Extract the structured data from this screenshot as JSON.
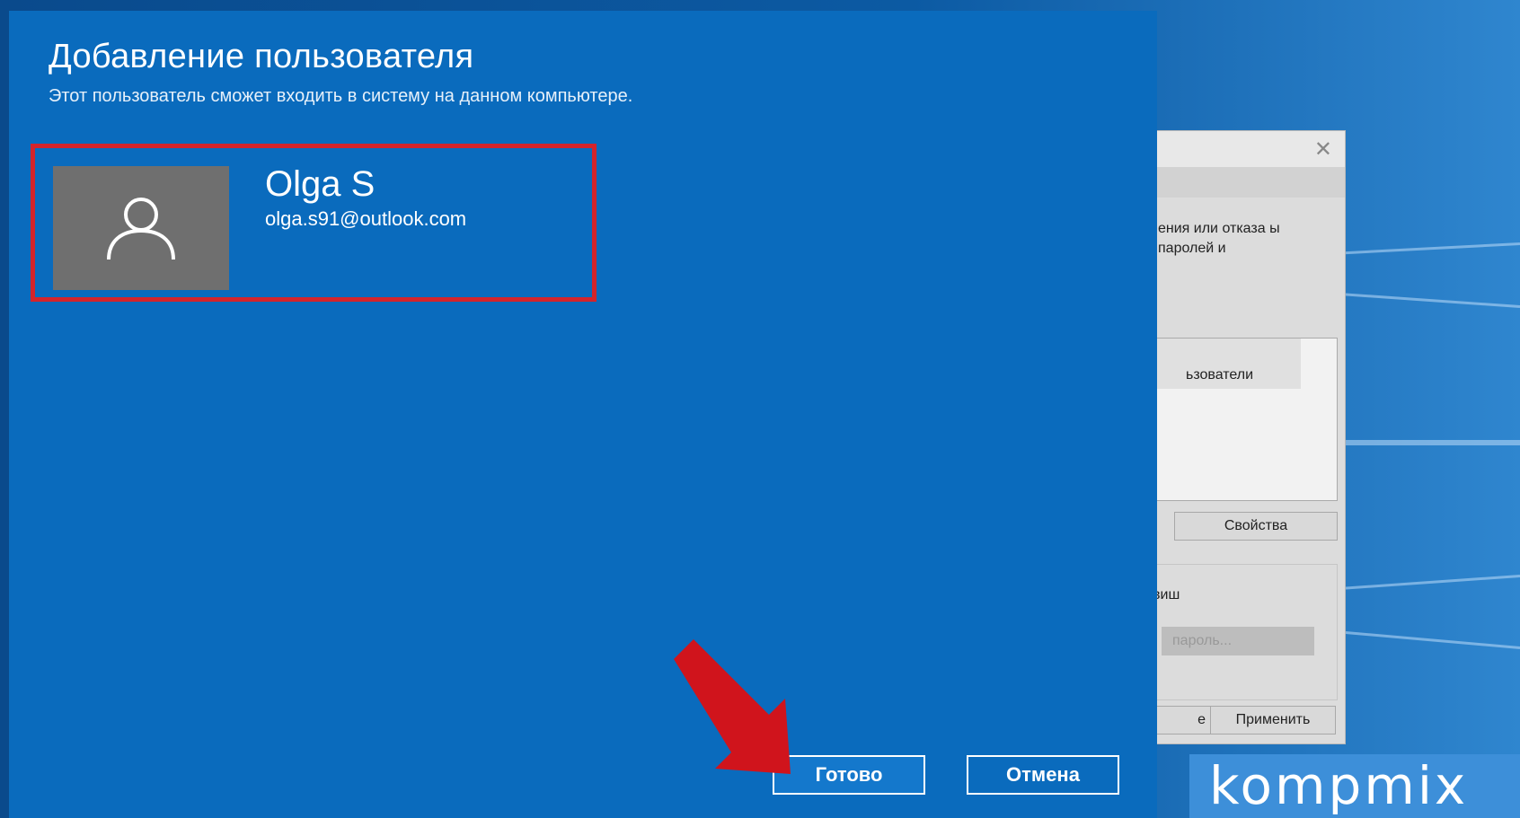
{
  "dialog": {
    "title": "Добавление пользователя",
    "subtitle": "Этот пользователь сможет входить в систему на данном компьютере."
  },
  "user": {
    "name": "Olga S",
    "email": "olga.s91@outlook.com",
    "avatar_icon": "person-icon"
  },
  "buttons": {
    "done_label": "Готово",
    "cancel_label": "Отмена"
  },
  "background_window": {
    "close_icon": "close-icon",
    "description": "ения или отказа ы паролей и",
    "list_item": "ьзователи",
    "properties_label": "Свойства",
    "group_label": "виш",
    "password_label": "пароль...",
    "ok_label": "е",
    "apply_label": "Применить"
  },
  "watermark": "kompmix",
  "colors": {
    "dialog_blue": "#0a6bbd",
    "highlight_red": "#d4242b",
    "arrow_red": "#d0141c"
  }
}
